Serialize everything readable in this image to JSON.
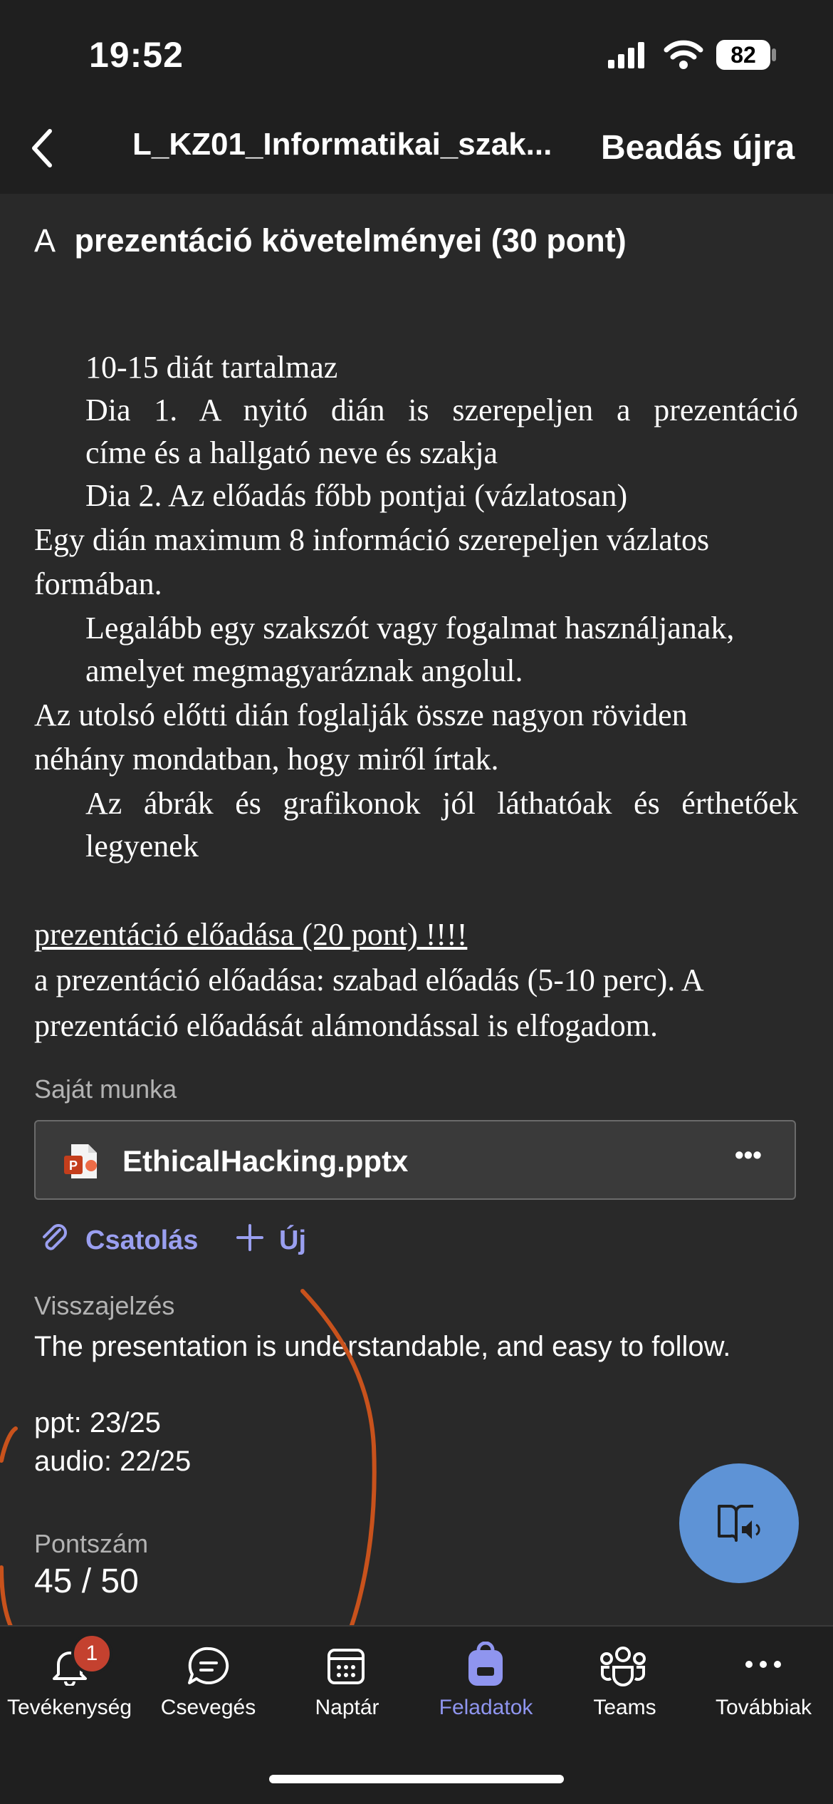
{
  "status_bar": {
    "time": "19:52",
    "battery": "82"
  },
  "nav": {
    "title": "L_KZ01_Informatikai_szak...",
    "action": "Beadás újra"
  },
  "section": {
    "prefix": "A",
    "title": "prezentáció követelményei  (30 pont)"
  },
  "requirements": {
    "l1": "10-15 diát tartalmaz",
    "l2a": "Dia 1. A nyitó dián is szerepeljen a prezentáció",
    "l2b": "címe és a hallgató neve és szakja",
    "l3": "Dia 2. Az előadás főbb pontjai (vázlatosan)",
    "l4a": "Egy dián maximum 8 információ szerepeljen vázlatos",
    "l4b": "formában.",
    "l5a": "Legalább egy szakszót vagy fogalmat használjanak,",
    "l5b": "amelyet megmagyaráznak angolul.",
    "l6a": "Az utolsó előtti dián foglalják össze nagyon röviden",
    "l6b": "néhány mondatban, hogy miről írtak.",
    "l7a": "Az ábrák és grafikonok jól láthatóak és érthetőek",
    "l7b": "legyenek"
  },
  "presentation": {
    "heading": "prezentáció előadása (20 pont) !!!!",
    "line1": "a prezentáció előadása: szabad előadás (5-10 perc).  A",
    "line2": "prezentáció előadását alámondással is elfogadom."
  },
  "own_work": {
    "label": "Saját munka",
    "file_name": "EthicalHacking.pptx",
    "more": "•••"
  },
  "actions": {
    "attach": "Csatolás",
    "new": "Új"
  },
  "feedback": {
    "label": "Visszajelzés",
    "text": "The presentation is understandable, and easy to follow.",
    "ppt": "ppt: 23/25",
    "audio": "audio: 22/25"
  },
  "score": {
    "label": "Pontszám",
    "value": "45 / 50"
  },
  "tabs": [
    {
      "label": "Tevékenység",
      "badge": "1"
    },
    {
      "label": "Csevegés"
    },
    {
      "label": "Naptár"
    },
    {
      "label": "Feladatok"
    },
    {
      "label": "Teams"
    },
    {
      "label": "Továbbiak"
    }
  ],
  "colors": {
    "accent": "#8f95ef",
    "background": "#292929",
    "annotation": "#c8521c"
  }
}
